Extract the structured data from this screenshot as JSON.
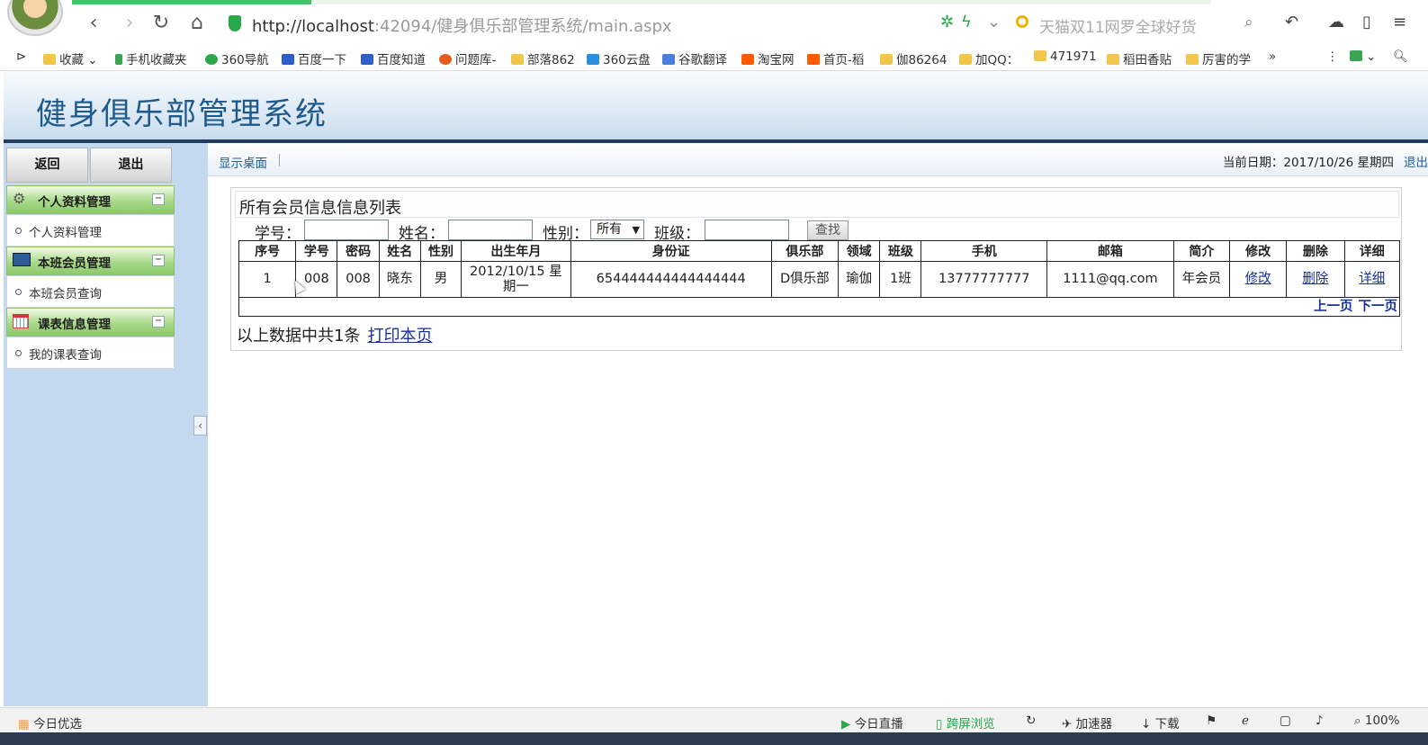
{
  "browser": {
    "url_host": "http://localhost",
    "url_path": ":42094/健身俱乐部管理系统/main.aspx",
    "search_placeholder": "天猫双11网罗全球好货",
    "bookmarks": [
      "收藏",
      "手机收藏夹",
      "360导航",
      "百度一下",
      "百度知道",
      "问题库-",
      "部落862",
      "360云盘",
      "谷歌翻译",
      "淘宝网",
      "首页-稻",
      "伽86264",
      "加QQ：",
      "471971",
      "稻田香贴",
      "厉害的学"
    ],
    "more": "»"
  },
  "header": {
    "title": "健身俱乐部管理系统"
  },
  "toolbar": {
    "desktop": "显示桌面",
    "date": "当前日期：2017/10/26 星期四",
    "logout": "退出"
  },
  "sidebar": {
    "back": "返回",
    "exit": "退出",
    "groups": [
      {
        "title": "个人资料管理",
        "item": "个人资料管理"
      },
      {
        "title": "本班会员管理",
        "item": "本班会员查询"
      },
      {
        "title": "课表信息管理",
        "item": "我的课表查询"
      }
    ],
    "collapse": "‹"
  },
  "panel": {
    "title": "所有会员信息信息列表",
    "filters": {
      "student_no": "学号：",
      "name": "姓名：",
      "gender": "性别：",
      "gender_value": "所有",
      "class": "班级：",
      "search": "查找"
    },
    "columns": [
      "序号",
      "学号",
      "密码",
      "姓名",
      "性别",
      "出生年月",
      "身份证",
      "俱乐部",
      "领域",
      "班级",
      "手机",
      "邮箱",
      "简介",
      "修改",
      "删除",
      "详细"
    ],
    "rows": [
      {
        "idx": "1",
        "no": "008",
        "pwd": "008",
        "name": "晓东",
        "gender": "男",
        "birth": "2012/10/15 星期一",
        "idcard": "654444444444444444",
        "club": "D俱乐部",
        "field": "瑜伽",
        "cls": "1班",
        "phone": "13777777777",
        "email": "1111@qq.com",
        "intro": "年会员",
        "edit": "修改",
        "del": "删除",
        "detail": "详细"
      }
    ],
    "prev": "上一页",
    "next": "下一页",
    "summary": "以上数据中共1条",
    "print": "打印本页"
  },
  "statusbar": {
    "picks": "今日优选",
    "live": "今日直播",
    "cross": "跨屏浏览",
    "accel": "加速器",
    "download": "下载",
    "zoom": "100%"
  }
}
